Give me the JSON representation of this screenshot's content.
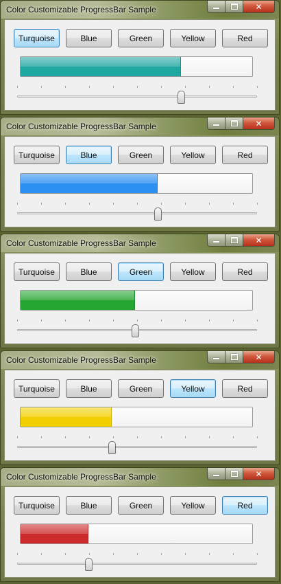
{
  "windows": [
    {
      "title": "Color Customizable ProgressBar Sample",
      "buttons": [
        "Turquoise",
        "Blue",
        "Green",
        "Yellow",
        "Red"
      ],
      "active_button": "Turquoise",
      "progress_percent": 69,
      "slider_percent": 69,
      "fill_color": "#1fa7a1"
    },
    {
      "title": "Color Customizable ProgressBar Sample",
      "buttons": [
        "Turquoise",
        "Blue",
        "Green",
        "Yellow",
        "Red"
      ],
      "active_button": "Blue",
      "progress_percent": 59,
      "slider_percent": 59,
      "fill_color": "#2c8ff2"
    },
    {
      "title": "Color Customizable ProgressBar Sample",
      "buttons": [
        "Turquoise",
        "Blue",
        "Green",
        "Yellow",
        "Red"
      ],
      "active_button": "Green",
      "progress_percent": 49,
      "slider_percent": 49,
      "fill_color": "#25a531"
    },
    {
      "title": "Color Customizable ProgressBar Sample",
      "buttons": [
        "Turquoise",
        "Blue",
        "Green",
        "Yellow",
        "Red"
      ],
      "active_button": "Yellow",
      "progress_percent": 39,
      "slider_percent": 39,
      "fill_color": "#f2cf00"
    },
    {
      "title": "Color Customizable ProgressBar Sample",
      "buttons": [
        "Turquoise",
        "Blue",
        "Green",
        "Yellow",
        "Red"
      ],
      "active_button": "Red",
      "progress_percent": 29,
      "slider_percent": 29,
      "fill_color": "#cd2b2b"
    }
  ],
  "icons": {
    "minimize": "minimize-icon",
    "maximize": "maximize-icon",
    "close": "close-icon"
  }
}
